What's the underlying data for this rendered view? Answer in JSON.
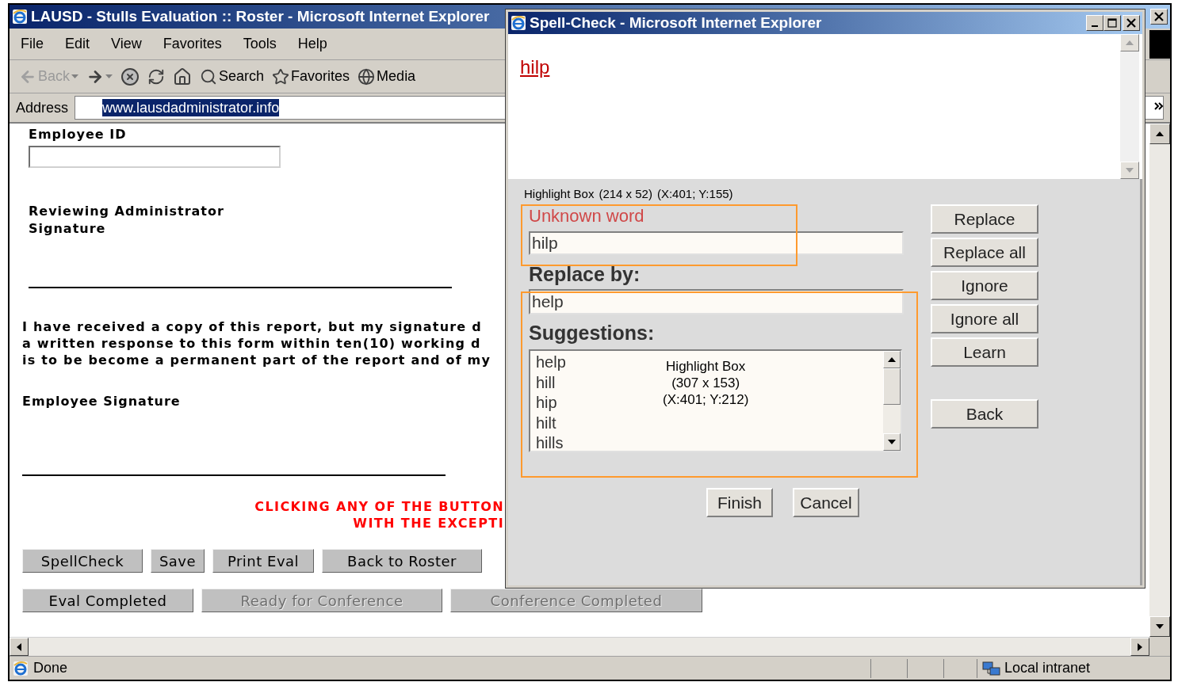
{
  "main_window": {
    "title": "LAUSD - Stulls Evaluation :: Roster - Microsoft Internet Explorer",
    "menu": [
      "File",
      "Edit",
      "View",
      "Favorites",
      "Tools",
      "Help"
    ],
    "toolbar": [
      {
        "kind": "back",
        "label": "Back",
        "disabled": true
      },
      {
        "kind": "forward",
        "disabled": false
      },
      {
        "kind": "stop",
        "disabled": false
      },
      {
        "kind": "refresh",
        "disabled": false
      },
      {
        "kind": "home",
        "disabled": false
      },
      {
        "kind": "search",
        "label": "Search",
        "disabled": false
      },
      {
        "kind": "favorites",
        "label": "Favorites",
        "disabled": false
      },
      {
        "kind": "media",
        "label": "Media",
        "disabled": false
      }
    ],
    "address": {
      "label": "Address",
      "value": "www.lausdadministrator.info"
    },
    "form": {
      "employee_id_label": "Employee ID",
      "reviewer_label": "Reviewing Administrator Signature",
      "statement_lines": [
        "I have received a copy of this report, but my signature d",
        "a written response to this form within ten(10) working d",
        "is to be become a permanent part of the report and of my"
      ],
      "employee_signature_label": "Employee Signature",
      "notice_lines": [
        "CLICKING ANY OF THE BUTTON",
        "WITH THE EXCEPTI"
      ],
      "button_rows": [
        [
          {
            "label": "SpellCheck",
            "disabled": false
          },
          {
            "label": "Save",
            "disabled": false
          },
          {
            "label": "Print Eval",
            "disabled": false
          },
          {
            "label": "Back to Roster",
            "disabled": false
          }
        ],
        [
          {
            "label": "Eval Completed",
            "disabled": false
          },
          {
            "label": "Ready for Conference",
            "disabled": true
          },
          {
            "label": "Conference Completed",
            "disabled": true
          }
        ]
      ]
    },
    "status_bar": {
      "text": "Done",
      "zone": "Local intranet"
    }
  },
  "spell_check": {
    "title": "Spell-Check - Microsoft Internet Explorer",
    "preview_word": "hilp",
    "unknown_word_label": "Unknown word",
    "unknown_word": "hilp",
    "replace_label": "Replace by:",
    "replace_value": "help",
    "suggestions_label": "Suggestions:",
    "suggestions": [
      "help",
      "hill",
      "hip",
      "hilt",
      "hills"
    ],
    "side_buttons": [
      "Replace",
      "Replace all",
      "Ignore",
      "Ignore all",
      "Learn"
    ],
    "back_button": "Back",
    "bottom_buttons": [
      "Finish",
      "Cancel"
    ],
    "highlight_boxes": [
      {
        "title": "Highlight Box",
        "size": "(214 x 52)",
        "position": "(X:401; Y:155)"
      },
      {
        "title": "Highlight Box",
        "size": "(307 x 153)",
        "position": "(X:401; Y:212)"
      }
    ]
  }
}
